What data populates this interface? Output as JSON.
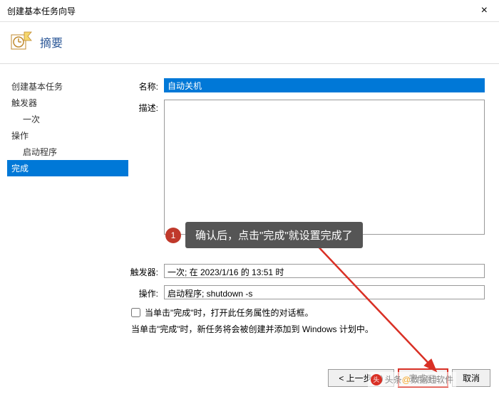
{
  "window": {
    "title": "创建基本任务向导",
    "close_glyph": "×"
  },
  "header": {
    "heading": "摘要"
  },
  "sidebar": {
    "items": [
      {
        "label": "创建基本任务",
        "indent": false,
        "selected": false
      },
      {
        "label": "触发器",
        "indent": false,
        "selected": false
      },
      {
        "label": "一次",
        "indent": true,
        "selected": false
      },
      {
        "label": "操作",
        "indent": false,
        "selected": false
      },
      {
        "label": "启动程序",
        "indent": true,
        "selected": false
      },
      {
        "label": "完成",
        "indent": false,
        "selected": true
      }
    ]
  },
  "form": {
    "name_label": "名称:",
    "name_value": "自动关机",
    "desc_label": "描述:",
    "desc_value": "",
    "trigger_label": "触发器:",
    "trigger_value": "一次;  在 2023/1/16 的 13:51 时",
    "action_label": "操作:",
    "action_value": "启动程序; shutdown -s",
    "checkbox_label": "当单击\"完成\"时，打开此任务属性的对话框。",
    "info_text": "当单击\"完成\"时，新任务将会被创建并添加到 Windows 计划中。"
  },
  "callout": {
    "number": "1",
    "text": "确认后，点击\"完成\"就设置完成了"
  },
  "buttons": {
    "back": "< 上一步(B)",
    "finish": "完成(F)",
    "cancel": "取消"
  },
  "watermark": {
    "prefix": "头条",
    "at": "@",
    "name": "数据蛙软件"
  }
}
